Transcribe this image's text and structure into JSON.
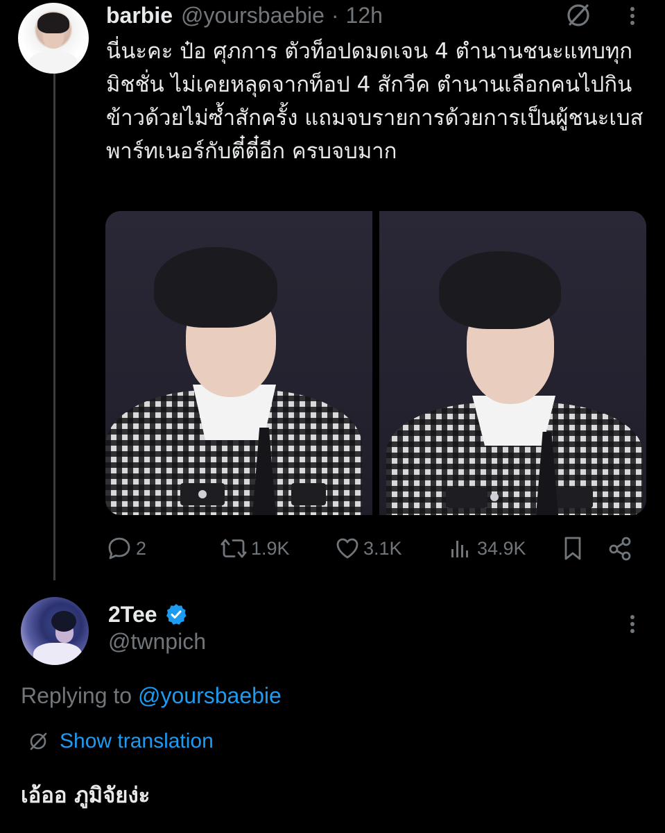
{
  "colors": {
    "background": "#000000",
    "text": "#e7e9ea",
    "muted": "#71767b",
    "accent": "#1d9bf0",
    "thread_line": "#3a3d41"
  },
  "tweet1": {
    "author_name": "barbie",
    "handle": "@yoursbaebie",
    "separator": "·",
    "time": "12h",
    "header_icon": "translate-icon",
    "more_icon": "more-vertical-icon",
    "text": "นี่นะคะ ป๋อ ศุภการ ตัวท็อปดมดเจน 4 ตำนานชนะแทบทุกมิชชั่น ไม่เคยหลุดจากท็อป 4 สักวีค ตำนานเลือกคนไปกินข้าวด้วยไม่ซ้ำสักครั้ง แถมจบรายการด้วยการเป็นผู้ชนะเบสพาร์ทเนอร์กับตี๋ตี๋อีก ครบจบมาก",
    "media": [
      "photo-left",
      "photo-right"
    ],
    "actions": {
      "replies": "2",
      "retweets": "1.9K",
      "likes": "3.1K",
      "views": "34.9K"
    },
    "action_icons": [
      "reply-icon",
      "retweet-icon",
      "like-icon",
      "views-icon",
      "bookmark-icon",
      "share-icon"
    ]
  },
  "tweet2": {
    "author_name": "2Tee",
    "verified": true,
    "handle": "@twnpich",
    "more_icon": "more-vertical-icon",
    "replying_prefix": "Replying to ",
    "replying_handle": "@yoursbaebie",
    "show_translation": "Show translation",
    "text": "เอ้ออ ภูมิจัยง่ะ"
  }
}
